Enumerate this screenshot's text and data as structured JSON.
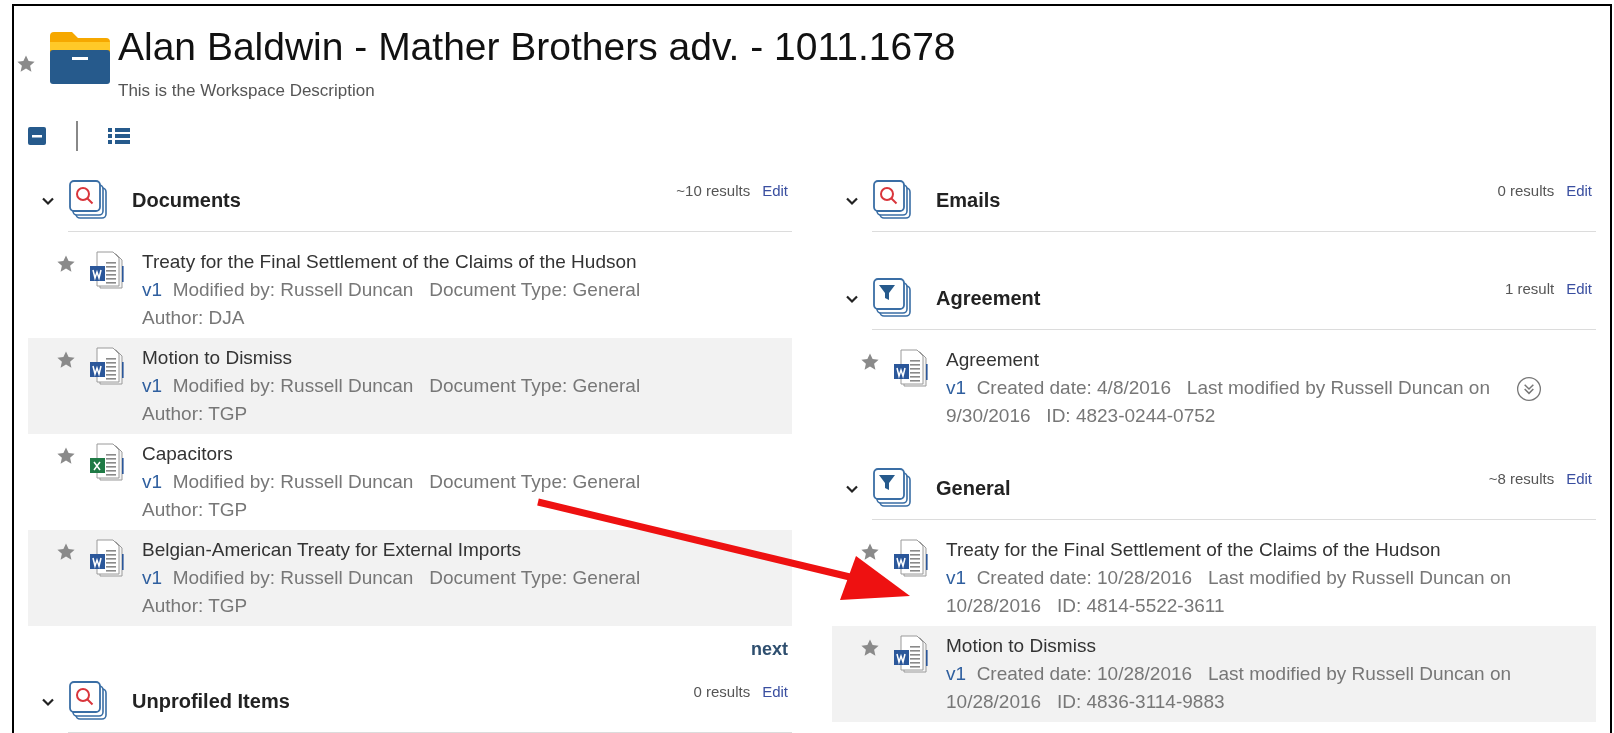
{
  "workspace": {
    "title": "Alan Baldwin - Mather Brothers adv. - 1011.1678",
    "description": "This is the Workspace Description",
    "favorite": false
  },
  "columns": [
    {
      "sections": [
        {
          "title": "Documents",
          "kind": "search",
          "expanded": true,
          "count": "~10 results",
          "edit": "Edit",
          "more": "next",
          "items": [
            {
              "title": "Treaty for the Final Settlement of the Claims of the Hudson",
              "kind": "word",
              "version": "v1",
              "details": "Modified by: Russell Duncan   Document Type: General   Author: DJA",
              "favorite": false,
              "expandable": false
            },
            {
              "title": "Motion to Dismiss",
              "kind": "word",
              "version": "v1",
              "details": "Modified by: Russell Duncan   Document Type: General   Author: TGP",
              "favorite": false,
              "expandable": false
            },
            {
              "title": "Capacitors",
              "kind": "excel",
              "version": "v1",
              "details": "Modified by: Russell Duncan   Document Type: General   Author: TGP",
              "favorite": false,
              "expandable": false
            },
            {
              "title": "Belgian-American Treaty for External Imports",
              "kind": "word",
              "version": "v1",
              "details": "Modified by: Russell Duncan   Document Type: General   Author: TGP",
              "favorite": false,
              "expandable": false
            }
          ]
        },
        {
          "title": "Unprofiled Items",
          "kind": "search",
          "expanded": true,
          "count": "0 results",
          "edit": "Edit"
        }
      ]
    },
    {
      "sections": [
        {
          "title": "Emails",
          "kind": "search",
          "expanded": true,
          "count": "0 results",
          "edit": "Edit"
        },
        {
          "title": "Agreement",
          "kind": "filter",
          "expanded": true,
          "count": "1 result",
          "edit": "Edit",
          "items": [
            {
              "title": "Agreement",
              "kind": "word",
              "version": "v1",
              "details": "Created date: 4/8/2016   Last modified by Russell Duncan on 9/30/2016   ID: 4823-0244-0752",
              "favorite": false,
              "expandable": true
            }
          ]
        },
        {
          "title": "General",
          "kind": "filter",
          "expanded": true,
          "count": "~8 results",
          "edit": "Edit",
          "items": [
            {
              "title": "Treaty for the Final Settlement of the Claims of the Hudson",
              "kind": "word",
              "version": "v1",
              "details": "Created date: 10/28/2016   Last modified by Russell Duncan on 10/28/2016   ID: 4814-5522-3611",
              "favorite": false,
              "expandable": false
            },
            {
              "title": "Motion to Dismiss",
              "kind": "word",
              "version": "v1",
              "details": "Created date: 10/28/2016   Last modified by Russell Duncan on 10/28/2016   ID: 4836-3114-9883",
              "favorite": false,
              "expandable": false
            }
          ]
        }
      ]
    }
  ]
}
